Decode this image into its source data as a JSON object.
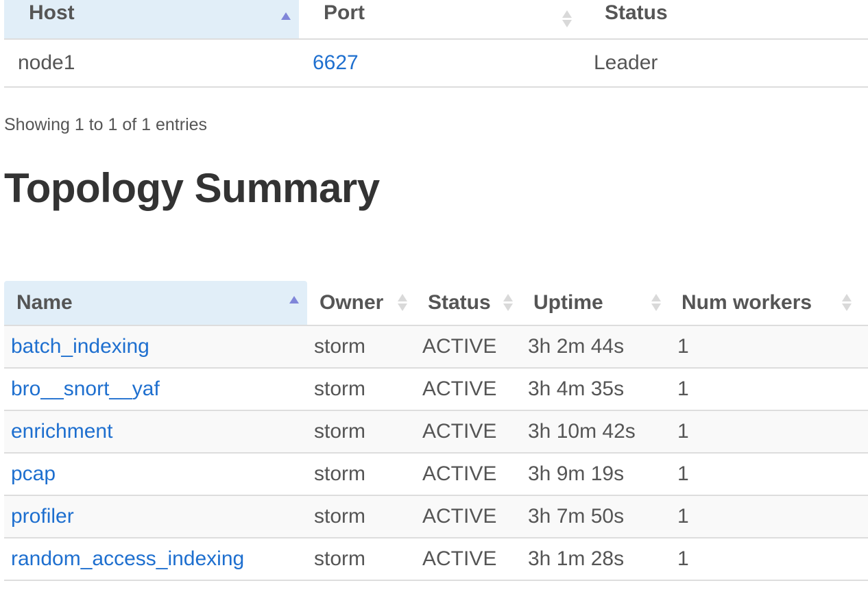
{
  "nimbus_table": {
    "headers": [
      "Host",
      "Port",
      "Status"
    ],
    "rows": [
      {
        "host": "node1",
        "port": "6627",
        "status": "Leader"
      }
    ]
  },
  "info_text": "Showing 1 to 1 of 1 entries",
  "topology_heading": "Topology Summary",
  "topology_table": {
    "headers": [
      "Name",
      "Owner",
      "Status",
      "Uptime",
      "Num workers"
    ],
    "rows": [
      {
        "name": "batch_indexing",
        "owner": "storm",
        "status": "ACTIVE",
        "uptime": "3h 2m 44s",
        "workers": "1"
      },
      {
        "name": "bro__snort__yaf",
        "owner": "storm",
        "status": "ACTIVE",
        "uptime": "3h 4m 35s",
        "workers": "1"
      },
      {
        "name": "enrichment",
        "owner": "storm",
        "status": "ACTIVE",
        "uptime": "3h 10m 42s",
        "workers": "1"
      },
      {
        "name": "pcap",
        "owner": "storm",
        "status": "ACTIVE",
        "uptime": "3h 9m 19s",
        "workers": "1"
      },
      {
        "name": "profiler",
        "owner": "storm",
        "status": "ACTIVE",
        "uptime": "3h 7m 50s",
        "workers": "1"
      },
      {
        "name": "random_access_indexing",
        "owner": "storm",
        "status": "ACTIVE",
        "uptime": "3h 1m 28s",
        "workers": "1"
      }
    ]
  },
  "colors": {
    "link": "#1e6fcf",
    "sorted_header_bg": "#e1eef8",
    "sort_arrow_active": "#8086d9",
    "sort_arrow_inactive": "#d9d9d9"
  }
}
